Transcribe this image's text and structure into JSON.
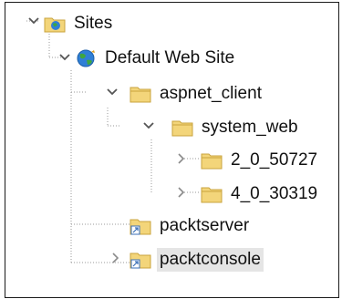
{
  "tree": {
    "nodes": [
      {
        "id": "sites",
        "label": "Sites",
        "icon": "sites-icon",
        "expander": "expanded",
        "selected": false
      },
      {
        "id": "default-web-site",
        "label": "Default Web Site",
        "icon": "globe-icon",
        "expander": "expanded",
        "selected": false
      },
      {
        "id": "aspnet-client",
        "label": "aspnet_client",
        "icon": "folder-icon",
        "expander": "expanded",
        "selected": false
      },
      {
        "id": "system-web",
        "label": "system_web",
        "icon": "folder-icon",
        "expander": "expanded",
        "selected": false
      },
      {
        "id": "v2",
        "label": "2_0_50727",
        "icon": "folder-icon",
        "expander": "collapsed",
        "selected": false
      },
      {
        "id": "v4",
        "label": "4_0_30319",
        "icon": "folder-icon",
        "expander": "collapsed",
        "selected": false
      },
      {
        "id": "packtserver",
        "label": "packtserver",
        "icon": "application-folder-icon",
        "expander": "none",
        "selected": false
      },
      {
        "id": "packtconsole",
        "label": "packtconsole",
        "icon": "application-folder-icon",
        "expander": "collapsed",
        "selected": true
      }
    ]
  },
  "colors": {
    "folder_fill": "#f3d57a",
    "folder_edge": "#c9a33c",
    "globe_blue": "#2f7fd6",
    "globe_green": "#3fa63f",
    "expander": "#555555",
    "selection": "#e5e5e5",
    "tree_line": "#9a9a9a"
  }
}
